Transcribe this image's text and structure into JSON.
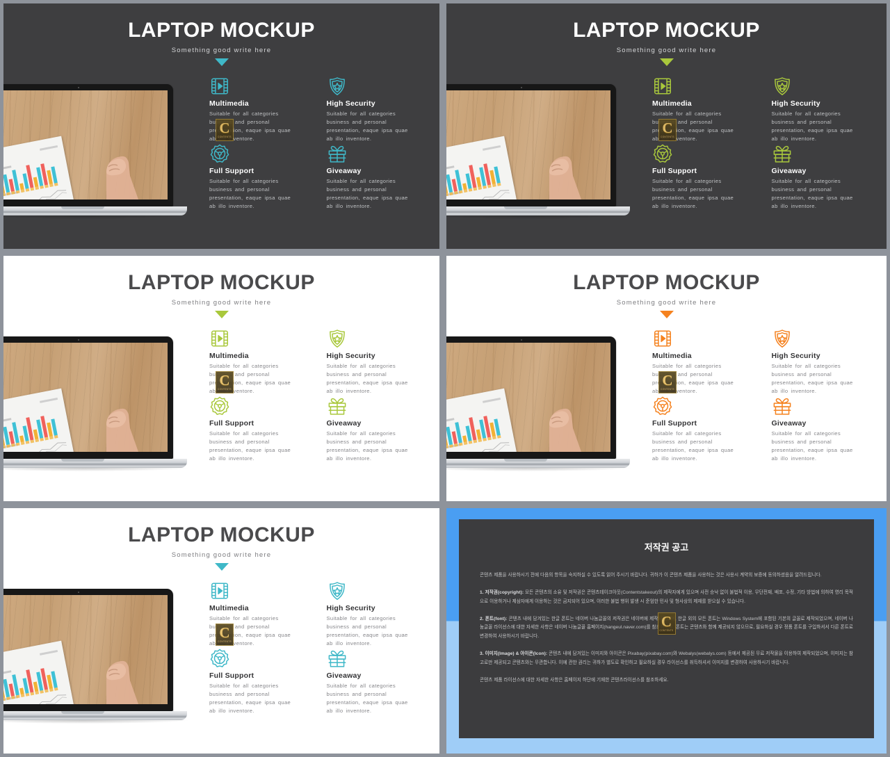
{
  "deck": {
    "title": "LAPTOP MOCKUP",
    "subtitle": "Something  good  write  here",
    "watermark": {
      "letter": "C",
      "caption": "CONTENTS"
    }
  },
  "features": [
    {
      "icon": "multimedia-film-play-icon",
      "title": "Multimedia",
      "body": "Suitable  for all categories  business  and personal  presentation,  eaque ipsa quae  ab illo inventore."
    },
    {
      "icon": "shield-star-security-icon",
      "title": "High Security",
      "body": "Suitable  for all categories  business  and personal  presentation,  eaque ipsa quae  ab illo inventore."
    },
    {
      "icon": "gear-support-icon",
      "title": "Full Support",
      "body": "Suitable  for all categories  business  and personal  presentation,  eaque ipsa quae  ab illo inventore."
    },
    {
      "icon": "gift-box-giveaway-icon",
      "title": "Giveaway",
      "body": "Suitable  for all categories  business  and personal  presentation,  eaque ipsa quae  ab illo inventore."
    }
  ],
  "slides": [
    {
      "id": 1,
      "theme": "dark",
      "background": "#3e3e40",
      "accent": "#3fb8c8",
      "title_color": "#ffffff"
    },
    {
      "id": 2,
      "theme": "dark",
      "background": "#3e3e40",
      "accent": "#a8c game",
      "accent_fix": "#a9c83c",
      "title_color": "#ffffff"
    },
    {
      "id": 3,
      "theme": "light",
      "background": "#ffffff",
      "accent": "#a9c83c",
      "title_color": "#4a4a4c"
    },
    {
      "id": 4,
      "theme": "light",
      "background": "#ffffff",
      "accent": "#f5821f",
      "title_color": "#4a4a4c"
    },
    {
      "id": 5,
      "theme": "light",
      "background": "#ffffff",
      "accent": "#3fb8c8",
      "title_color": "#4a4a4c"
    }
  ],
  "copyright_slide": {
    "title": "저작권 공고",
    "outer_color_top": "#4a9ef2",
    "outer_color_bottom": "#9fcdf7",
    "card_color": "#3c3c3e",
    "paragraphs": [
      {
        "lead": "",
        "text": "콘텐츠 제품을 사용하시기 전에 다음의 항목을 숙지하실 수 있도록 읽어 주시기 바랍니다. 귀하가 이 콘텐츠 제품을 사용하는 것은 사용시 계약의 보증에 동의하셨음을 알려드립니다."
      },
      {
        "lead": "1. 저작권(copyright):",
        "text": "모든 콘텐츠의 소유 및 저작권은 콘텐츠테이크아웃(Contentstakeout)의 제작자에게 있으며 사전 승낙 없이 불법적 이용, 무단전재, 배포, 수정, 기타 방법에 의하여 영리 목적으로 이용하거나 제삼자에게 이용하는 것은 금지되어 있으며, 이러한 불법 행위 발생 시 준엄한 민사 및 형사상의 제재를 받으실 수 있습니다."
      },
      {
        "lead": "2. 폰트(font):",
        "text": "콘텐츠 내에 담겨있는 한글 폰트는 네이버 나눔글꼴의 저작권은 네이버에 제작되었으며, 한글 외의 모든 폰트는 Windows System에 포함된 기본의 글꼴로 제작되었으며, 네이버 나눔글꼴 라이선스에 대한 자세한 사항은 네이버 나눔글꼴 홈페이지(hangeul.naver.com)를 참조하세요. 폰트는 콘텐츠와 함께 제공되지 않으므로, 필요하실 경우 정품 폰트를 구입하셔서 다른 폰트로 변경하여 사용하시기 바랍니다."
      },
      {
        "lead": "3. 이미지(Image) & 아이콘(Icon):",
        "text": "콘텐츠 내에 담겨있는 이미지와 아이콘은 Pixabay(pixabay.com)와 Webalys(webalys.com) 등에서 제공된 무료 저작물을 이용하여 제작되었으며, 이미지는 참고로만 제공되고 콘텐츠와는 무관합니다. 이에 관한 권리는 귀하가 별도로 확인하고 필요하실 경우 라이선스를 취득하셔서 이미지를 변경하여 사용하시기 바랍니다."
      },
      {
        "lead": "",
        "text": "콘텐츠 제품 라이선스에 대한 자세한 사항은 홈페이지 하단에 기재한 콘텐츠라이선스를 참조하세요."
      }
    ]
  }
}
